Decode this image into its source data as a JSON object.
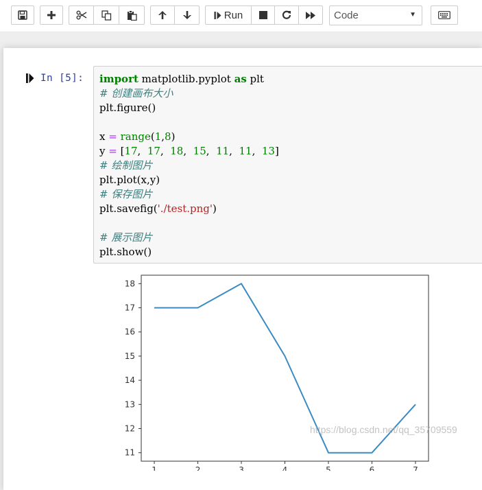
{
  "toolbar": {
    "run_label": "Run",
    "cell_type_selected": "Code",
    "icons": [
      "save-icon",
      "plus-icon",
      "scissors-icon",
      "copy-icon",
      "paste-icon",
      "arrow-up-icon",
      "arrow-down-icon",
      "step-icon",
      "stop-icon",
      "restart-icon",
      "fast-forward-icon",
      "keyboard-icon"
    ]
  },
  "cell": {
    "prompt": "In  [5]:",
    "code_lines": [
      [
        {
          "t": "import",
          "c": "kw"
        },
        {
          "t": " matplotlib.pyplot "
        },
        {
          "t": "as",
          "c": "kw"
        },
        {
          "t": " plt"
        }
      ],
      [
        {
          "t": "# 创建画布大小",
          "c": "cm"
        }
      ],
      [
        {
          "t": "plt.figure()"
        }
      ],
      [],
      [
        {
          "t": "x "
        },
        {
          "t": "=",
          "c": "op"
        },
        {
          "t": " "
        },
        {
          "t": "range",
          "c": "num"
        },
        {
          "t": "("
        },
        {
          "t": "1",
          "c": "num"
        },
        {
          "t": ","
        },
        {
          "t": "8",
          "c": "num"
        },
        {
          "t": ")"
        }
      ],
      [
        {
          "t": "y "
        },
        {
          "t": "=",
          "c": "op"
        },
        {
          "t": " ["
        },
        {
          "t": "17",
          "c": "num"
        },
        {
          "t": ",  "
        },
        {
          "t": "17",
          "c": "num"
        },
        {
          "t": ",  "
        },
        {
          "t": "18",
          "c": "num"
        },
        {
          "t": ",  "
        },
        {
          "t": "15",
          "c": "num"
        },
        {
          "t": ",  "
        },
        {
          "t": "11",
          "c": "num"
        },
        {
          "t": ",  "
        },
        {
          "t": "11",
          "c": "num"
        },
        {
          "t": ",  "
        },
        {
          "t": "13",
          "c": "num"
        },
        {
          "t": "]"
        }
      ],
      [
        {
          "t": "# 绘制图片",
          "c": "cm"
        }
      ],
      [
        {
          "t": "plt.plot(x,y)"
        }
      ],
      [
        {
          "t": "# 保存图片",
          "c": "cm"
        }
      ],
      [
        {
          "t": "plt.savefig("
        },
        {
          "t": "'./test.png'",
          "c": "str"
        },
        {
          "t": ")"
        }
      ],
      [],
      [
        {
          "t": "# 展示图片",
          "c": "cm"
        }
      ],
      [
        {
          "t": "plt.show()"
        }
      ]
    ]
  },
  "chart_data": {
    "type": "line",
    "x": [
      1,
      2,
      3,
      4,
      5,
      6,
      7
    ],
    "series": [
      {
        "values": [
          17,
          17,
          18,
          15,
          11,
          11,
          13
        ],
        "color": "#3b8bc2"
      }
    ],
    "xticks": [
      1,
      2,
      3,
      4,
      5,
      6,
      7
    ],
    "yticks": [
      11,
      12,
      13,
      14,
      15,
      16,
      17,
      18
    ],
    "xlim": [
      0.7,
      7.3
    ],
    "ylim": [
      10.65,
      18.35
    ],
    "grid": false,
    "legend": "none"
  },
  "watermark": "https://blog.csdn.net/qq_35709559"
}
